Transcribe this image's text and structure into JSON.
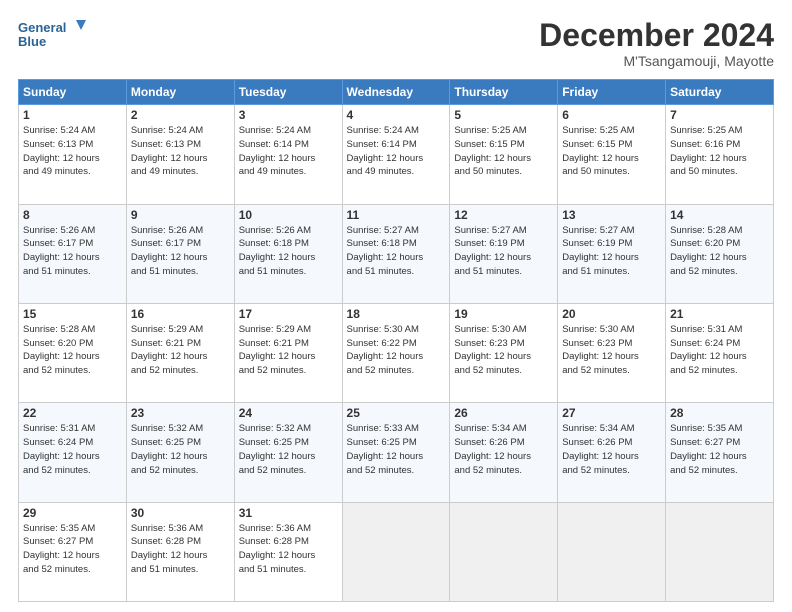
{
  "header": {
    "logo_line1": "General",
    "logo_line2": "Blue",
    "month": "December 2024",
    "location": "M'Tsangamouji, Mayotte"
  },
  "days_of_week": [
    "Sunday",
    "Monday",
    "Tuesday",
    "Wednesday",
    "Thursday",
    "Friday",
    "Saturday"
  ],
  "weeks": [
    [
      {
        "day": "1",
        "lines": [
          "Sunrise: 5:24 AM",
          "Sunset: 6:13 PM",
          "Daylight: 12 hours",
          "and 49 minutes."
        ]
      },
      {
        "day": "2",
        "lines": [
          "Sunrise: 5:24 AM",
          "Sunset: 6:13 PM",
          "Daylight: 12 hours",
          "and 49 minutes."
        ]
      },
      {
        "day": "3",
        "lines": [
          "Sunrise: 5:24 AM",
          "Sunset: 6:14 PM",
          "Daylight: 12 hours",
          "and 49 minutes."
        ]
      },
      {
        "day": "4",
        "lines": [
          "Sunrise: 5:24 AM",
          "Sunset: 6:14 PM",
          "Daylight: 12 hours",
          "and 49 minutes."
        ]
      },
      {
        "day": "5",
        "lines": [
          "Sunrise: 5:25 AM",
          "Sunset: 6:15 PM",
          "Daylight: 12 hours",
          "and 50 minutes."
        ]
      },
      {
        "day": "6",
        "lines": [
          "Sunrise: 5:25 AM",
          "Sunset: 6:15 PM",
          "Daylight: 12 hours",
          "and 50 minutes."
        ]
      },
      {
        "day": "7",
        "lines": [
          "Sunrise: 5:25 AM",
          "Sunset: 6:16 PM",
          "Daylight: 12 hours",
          "and 50 minutes."
        ]
      }
    ],
    [
      {
        "day": "8",
        "lines": [
          "Sunrise: 5:26 AM",
          "Sunset: 6:17 PM",
          "Daylight: 12 hours",
          "and 51 minutes."
        ]
      },
      {
        "day": "9",
        "lines": [
          "Sunrise: 5:26 AM",
          "Sunset: 6:17 PM",
          "Daylight: 12 hours",
          "and 51 minutes."
        ]
      },
      {
        "day": "10",
        "lines": [
          "Sunrise: 5:26 AM",
          "Sunset: 6:18 PM",
          "Daylight: 12 hours",
          "and 51 minutes."
        ]
      },
      {
        "day": "11",
        "lines": [
          "Sunrise: 5:27 AM",
          "Sunset: 6:18 PM",
          "Daylight: 12 hours",
          "and 51 minutes."
        ]
      },
      {
        "day": "12",
        "lines": [
          "Sunrise: 5:27 AM",
          "Sunset: 6:19 PM",
          "Daylight: 12 hours",
          "and 51 minutes."
        ]
      },
      {
        "day": "13",
        "lines": [
          "Sunrise: 5:27 AM",
          "Sunset: 6:19 PM",
          "Daylight: 12 hours",
          "and 51 minutes."
        ]
      },
      {
        "day": "14",
        "lines": [
          "Sunrise: 5:28 AM",
          "Sunset: 6:20 PM",
          "Daylight: 12 hours",
          "and 52 minutes."
        ]
      }
    ],
    [
      {
        "day": "15",
        "lines": [
          "Sunrise: 5:28 AM",
          "Sunset: 6:20 PM",
          "Daylight: 12 hours",
          "and 52 minutes."
        ]
      },
      {
        "day": "16",
        "lines": [
          "Sunrise: 5:29 AM",
          "Sunset: 6:21 PM",
          "Daylight: 12 hours",
          "and 52 minutes."
        ]
      },
      {
        "day": "17",
        "lines": [
          "Sunrise: 5:29 AM",
          "Sunset: 6:21 PM",
          "Daylight: 12 hours",
          "and 52 minutes."
        ]
      },
      {
        "day": "18",
        "lines": [
          "Sunrise: 5:30 AM",
          "Sunset: 6:22 PM",
          "Daylight: 12 hours",
          "and 52 minutes."
        ]
      },
      {
        "day": "19",
        "lines": [
          "Sunrise: 5:30 AM",
          "Sunset: 6:23 PM",
          "Daylight: 12 hours",
          "and 52 minutes."
        ]
      },
      {
        "day": "20",
        "lines": [
          "Sunrise: 5:30 AM",
          "Sunset: 6:23 PM",
          "Daylight: 12 hours",
          "and 52 minutes."
        ]
      },
      {
        "day": "21",
        "lines": [
          "Sunrise: 5:31 AM",
          "Sunset: 6:24 PM",
          "Daylight: 12 hours",
          "and 52 minutes."
        ]
      }
    ],
    [
      {
        "day": "22",
        "lines": [
          "Sunrise: 5:31 AM",
          "Sunset: 6:24 PM",
          "Daylight: 12 hours",
          "and 52 minutes."
        ]
      },
      {
        "day": "23",
        "lines": [
          "Sunrise: 5:32 AM",
          "Sunset: 6:25 PM",
          "Daylight: 12 hours",
          "and 52 minutes."
        ]
      },
      {
        "day": "24",
        "lines": [
          "Sunrise: 5:32 AM",
          "Sunset: 6:25 PM",
          "Daylight: 12 hours",
          "and 52 minutes."
        ]
      },
      {
        "day": "25",
        "lines": [
          "Sunrise: 5:33 AM",
          "Sunset: 6:25 PM",
          "Daylight: 12 hours",
          "and 52 minutes."
        ]
      },
      {
        "day": "26",
        "lines": [
          "Sunrise: 5:34 AM",
          "Sunset: 6:26 PM",
          "Daylight: 12 hours",
          "and 52 minutes."
        ]
      },
      {
        "day": "27",
        "lines": [
          "Sunrise: 5:34 AM",
          "Sunset: 6:26 PM",
          "Daylight: 12 hours",
          "and 52 minutes."
        ]
      },
      {
        "day": "28",
        "lines": [
          "Sunrise: 5:35 AM",
          "Sunset: 6:27 PM",
          "Daylight: 12 hours",
          "and 52 minutes."
        ]
      }
    ],
    [
      {
        "day": "29",
        "lines": [
          "Sunrise: 5:35 AM",
          "Sunset: 6:27 PM",
          "Daylight: 12 hours",
          "and 52 minutes."
        ]
      },
      {
        "day": "30",
        "lines": [
          "Sunrise: 5:36 AM",
          "Sunset: 6:28 PM",
          "Daylight: 12 hours",
          "and 51 minutes."
        ]
      },
      {
        "day": "31",
        "lines": [
          "Sunrise: 5:36 AM",
          "Sunset: 6:28 PM",
          "Daylight: 12 hours",
          "and 51 minutes."
        ]
      },
      null,
      null,
      null,
      null
    ]
  ]
}
